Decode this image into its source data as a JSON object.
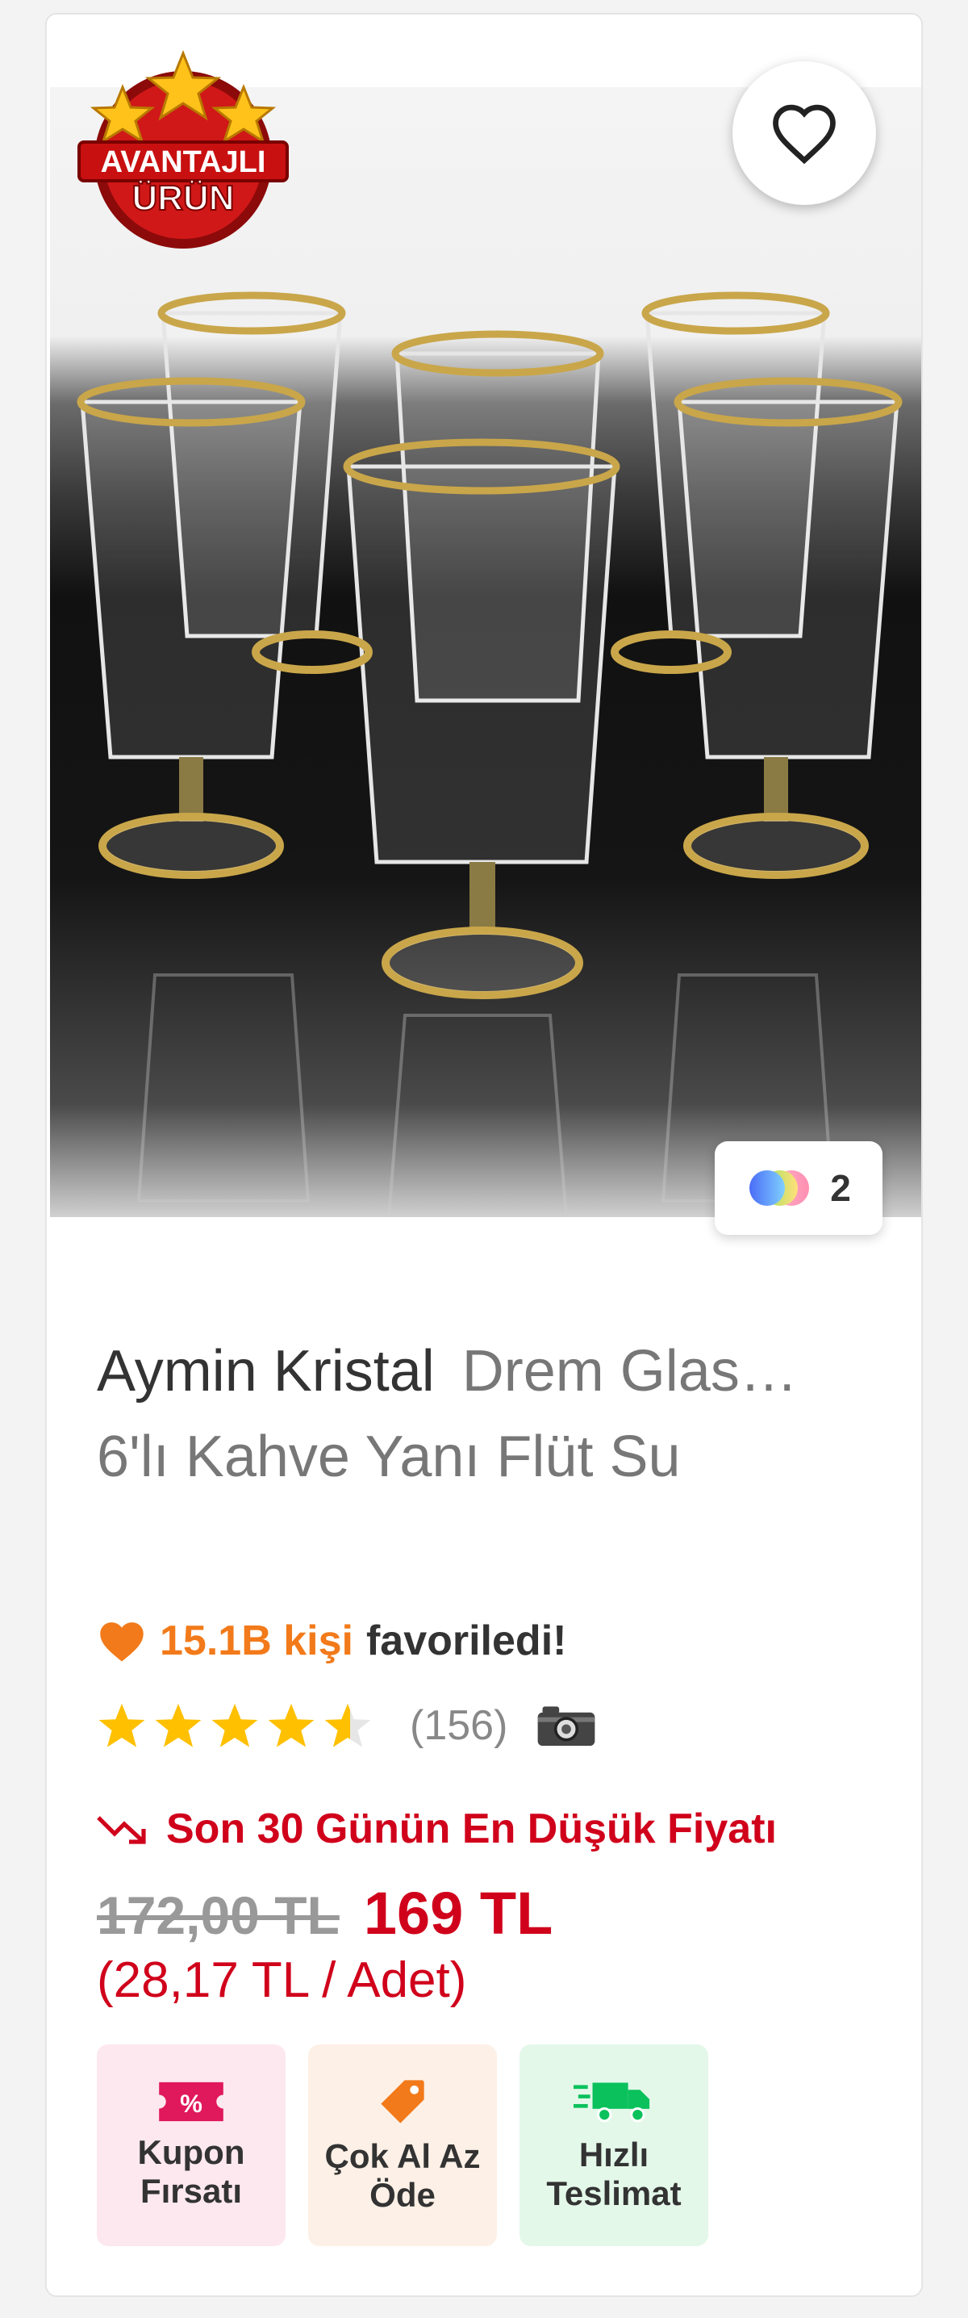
{
  "product": {
    "badge": {
      "line1": "AVANTAJLI",
      "line2": "ÜRÜN"
    },
    "variant_count": "2",
    "brand": "Aymin Kristal",
    "title_rest": "Drem Glas…",
    "title_line2": "6'lı Kahve Yanı Flüt Su",
    "favorites": {
      "count_text": "15.1B kişi",
      "suffix": "favoriledi!"
    },
    "rating": {
      "value": 4.5,
      "max": 5,
      "review_count": "(156)"
    },
    "lowest_price_label": "Son 30 Günün En Düşük Fiyatı",
    "old_price": "172,00 TL",
    "price": "169 TL",
    "unit_price": "(28,17 TL / Adet)"
  },
  "tags": [
    {
      "line1": "Kupon",
      "line2": "Fırsatı",
      "icon": "coupon-icon",
      "color": "#e0185c"
    },
    {
      "line1": "Çok Al Az",
      "line2": "Öde",
      "icon": "price-tag-icon",
      "color": "#f27a1a"
    },
    {
      "line1": "Hızlı",
      "line2": "Teslimat",
      "icon": "fast-delivery-icon",
      "color": "#0bc15c"
    }
  ],
  "colors": {
    "accent_orange": "#f27a1a",
    "price_red": "#d0011b",
    "star_yellow": "#ffc000"
  }
}
